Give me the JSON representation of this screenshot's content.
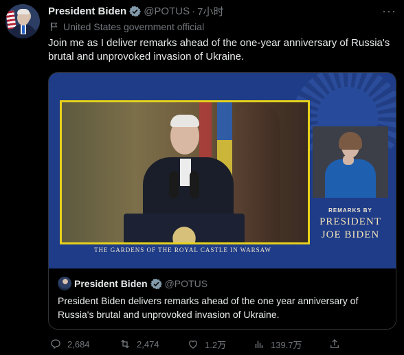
{
  "tweet": {
    "author_name": "President Biden",
    "handle": "@POTUS",
    "separator": "·",
    "time": "7小时",
    "label": "United States government official",
    "text": "Join me as I deliver remarks ahead of the one-year anniversary of Russia's brutal and unprovoked invasion of Ukraine.",
    "more_icon": "more-icon"
  },
  "card": {
    "video_caption": "THE GARDENS OF THE ROYAL CASTLE IN WARSAW",
    "remarks_by": "REMARKS BY",
    "remarks_line1": "PRESIDENT",
    "remarks_line2": "JOE BIDEN",
    "quoted": {
      "author_name": "President Biden",
      "handle": "@POTUS",
      "text": "President Biden delivers remarks ahead of the one year anniversary of Russia's brutal and unprovoked invasion of Ukraine."
    }
  },
  "actions": {
    "replies": "2,684",
    "retweets": "2,474",
    "likes": "1.2万",
    "views": "139.7万"
  },
  "colors": {
    "background": "#000000",
    "text": "#e7e9ea",
    "muted": "#71767b",
    "verified": "#829aab",
    "frame": "#e6d21c",
    "video_bg": "#1f3c88"
  }
}
